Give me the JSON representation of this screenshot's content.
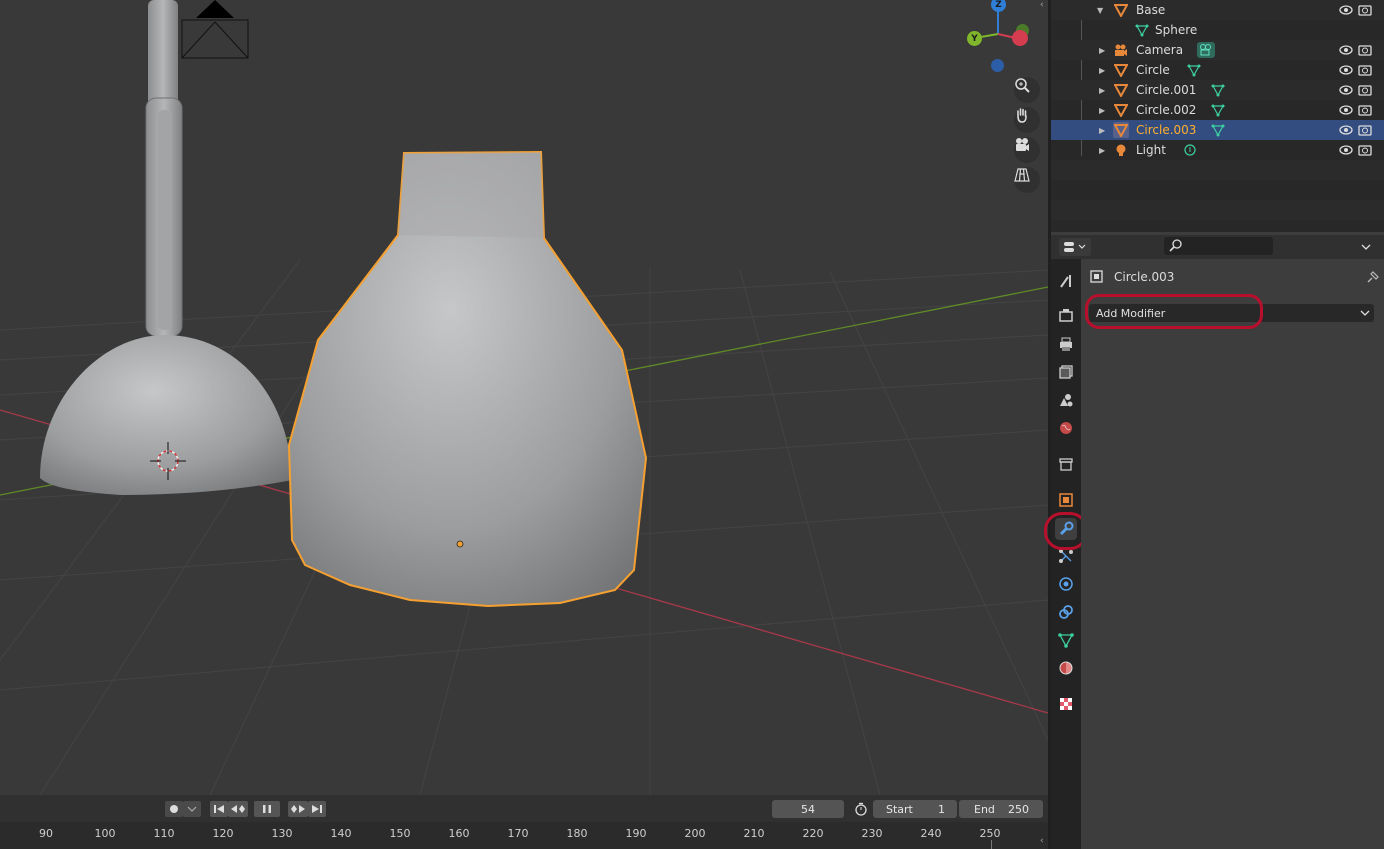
{
  "outliner": {
    "items": [
      {
        "label": "Base",
        "icon": "mesh-object-icon",
        "expanded": true
      },
      {
        "label": "Sphere",
        "icon": "mesh-data-icon"
      },
      {
        "label": "Camera",
        "icon": "camera-object-icon"
      },
      {
        "label": "Circle",
        "icon": "mesh-object-icon"
      },
      {
        "label": "Circle.001",
        "icon": "mesh-object-icon"
      },
      {
        "label": "Circle.002",
        "icon": "mesh-object-icon"
      },
      {
        "label": "Circle.003",
        "icon": "mesh-object-icon",
        "selected": true
      },
      {
        "label": "Light",
        "icon": "light-object-icon"
      }
    ]
  },
  "properties": {
    "object_name": "Circle.003",
    "add_modifier_label": "Add Modifier",
    "active_tab": "modifier-tab"
  },
  "viewport": {
    "gizmo_axes": [
      "Z",
      "Y"
    ],
    "colors": {
      "selection_outline": "#f5a030",
      "x_axis": "#b83a48",
      "y_axis": "#6a9a2a"
    }
  },
  "timeline": {
    "current_frame": "54",
    "start_label": "Start",
    "start_value": "1",
    "end_label": "End",
    "end_value": "250",
    "ruler_ticks": [
      "90",
      "100",
      "110",
      "120",
      "130",
      "140",
      "150",
      "160",
      "170",
      "180",
      "190",
      "200",
      "210",
      "220",
      "230",
      "240",
      "250"
    ]
  }
}
